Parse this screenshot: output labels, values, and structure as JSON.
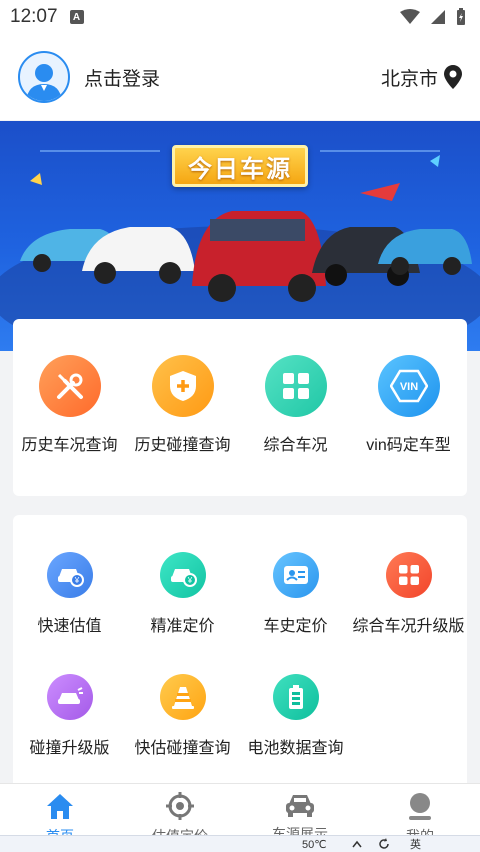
{
  "status": {
    "time": "12:07"
  },
  "header": {
    "login_text": "点击登录",
    "city": "北京市"
  },
  "banner": {
    "title": "今日车源"
  },
  "main_grid": [
    {
      "label": "历史车况查询",
      "icon": "tools-icon",
      "color": "#ff7e3d"
    },
    {
      "label": "历史碰撞查询",
      "icon": "shield-plus-icon",
      "color": "#ffa41c"
    },
    {
      "label": "综合车况",
      "icon": "grid-icon",
      "color": "#2fd3b4"
    },
    {
      "label": "vin码定车型",
      "icon": "vin-icon",
      "color": "#2aa8f5"
    }
  ],
  "service_grid": [
    {
      "label": "快速估值",
      "icon": "car-yen-icon",
      "color": "#4a8ff0"
    },
    {
      "label": "精准定价",
      "icon": "car-price-icon",
      "color": "#20d2b5"
    },
    {
      "label": "车史定价",
      "icon": "id-card-icon",
      "color": "#3fa9f5"
    },
    {
      "label": "综合车况升级版",
      "icon": "grid-icon",
      "color": "#ff5a3c"
    },
    {
      "label": "碰撞升级版",
      "icon": "crash-car-icon",
      "color": "#b56df0"
    },
    {
      "label": "快估碰撞查询",
      "icon": "cone-icon",
      "color": "#ffb422"
    },
    {
      "label": "电池数据查询",
      "icon": "battery-icon",
      "color": "#19c9a8"
    }
  ],
  "tabs": [
    {
      "label": "首页",
      "icon": "home-icon",
      "active": true
    },
    {
      "label": "估值定价",
      "icon": "target-icon",
      "active": false
    },
    {
      "label": "车源展示",
      "icon": "car-icon",
      "active": false
    },
    {
      "label": "我的",
      "icon": "user-icon",
      "active": false
    }
  ],
  "taskbar": {
    "temp": "50℃",
    "ime": "英"
  }
}
